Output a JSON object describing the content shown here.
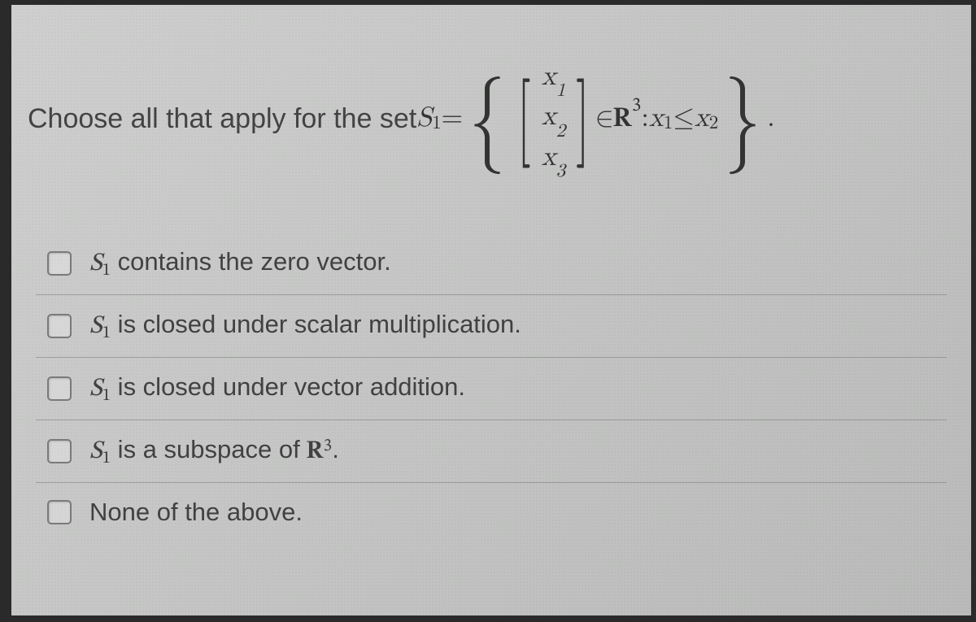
{
  "question": {
    "prompt_prefix": "Choose all that apply for the set ",
    "set_symbol": "S",
    "set_sub": "1",
    "equals": " = ",
    "vector_entries": [
      "x",
      "x",
      "x"
    ],
    "vector_subs": [
      "1",
      "2",
      "3"
    ],
    "membership": " ∈ ",
    "space_R": "R",
    "space_sup": "3",
    "colon": " : ",
    "cond_lhs_var": "x",
    "cond_lhs_sub": "1",
    "cond_rel": " ≤ ",
    "cond_rhs_var": "x",
    "cond_rhs_sub": "2",
    "period": "."
  },
  "options": [
    {
      "S": "S",
      "sub": "1",
      "rest": " contains the zero vector."
    },
    {
      "S": "S",
      "sub": "1",
      "rest": " is closed under scalar multiplication."
    },
    {
      "S": "S",
      "sub": "1",
      "rest": " is closed under vector addition."
    },
    {
      "S": "S",
      "sub": "1",
      "rest": " is a subspace of ",
      "R": "R",
      "Rsup": "3",
      "tail": "."
    },
    {
      "plain": "None of the above."
    }
  ]
}
